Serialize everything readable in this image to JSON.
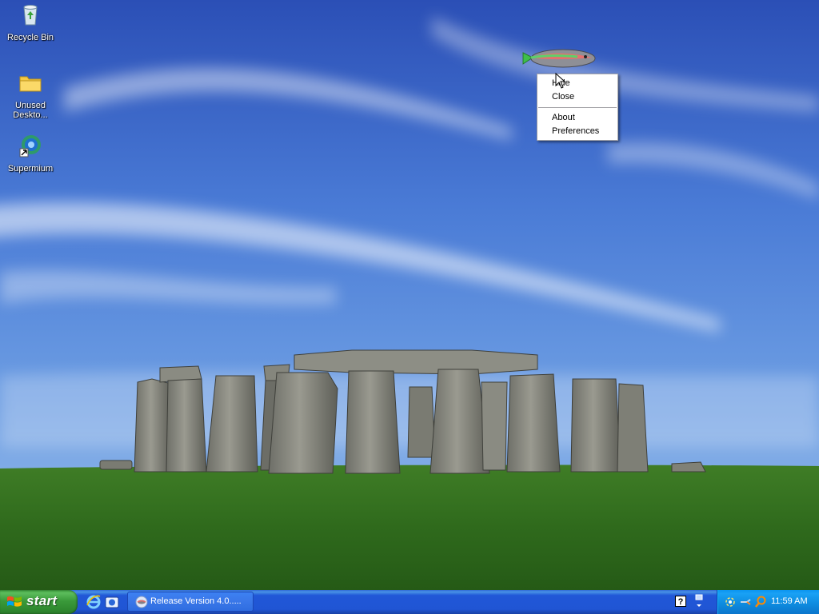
{
  "desktop": {
    "icons": [
      {
        "label": "Recycle Bin",
        "icon": "recycle-bin-icon"
      },
      {
        "label": "Unused Deskto...",
        "icon": "folder-icon"
      },
      {
        "label": "Supermium",
        "icon": "supermium-browser-icon"
      }
    ],
    "wallpaper": "stonehenge"
  },
  "context_menu": {
    "items": [
      "Hide",
      "Close",
      "About",
      "Preferences"
    ]
  },
  "taskbar": {
    "start_label": "start",
    "quick_launch": [
      "internet-explorer-icon",
      "show-desktop-icon"
    ],
    "tasks": [
      {
        "label": "Release Version 4.0.....",
        "icon": "fish-app-icon"
      }
    ],
    "tray": {
      "icons": [
        "help-icon",
        "expand-tray-icon",
        "network-icon",
        "volume-icon",
        "search-icon"
      ],
      "clock": "11:59 AM"
    }
  },
  "colors": {
    "taskbar_blue": "#2157d7",
    "start_green": "#3a9a3a",
    "tray_blue": "#0d8ade",
    "sky": "#3a62c9",
    "grass": "#2f6a1e"
  }
}
